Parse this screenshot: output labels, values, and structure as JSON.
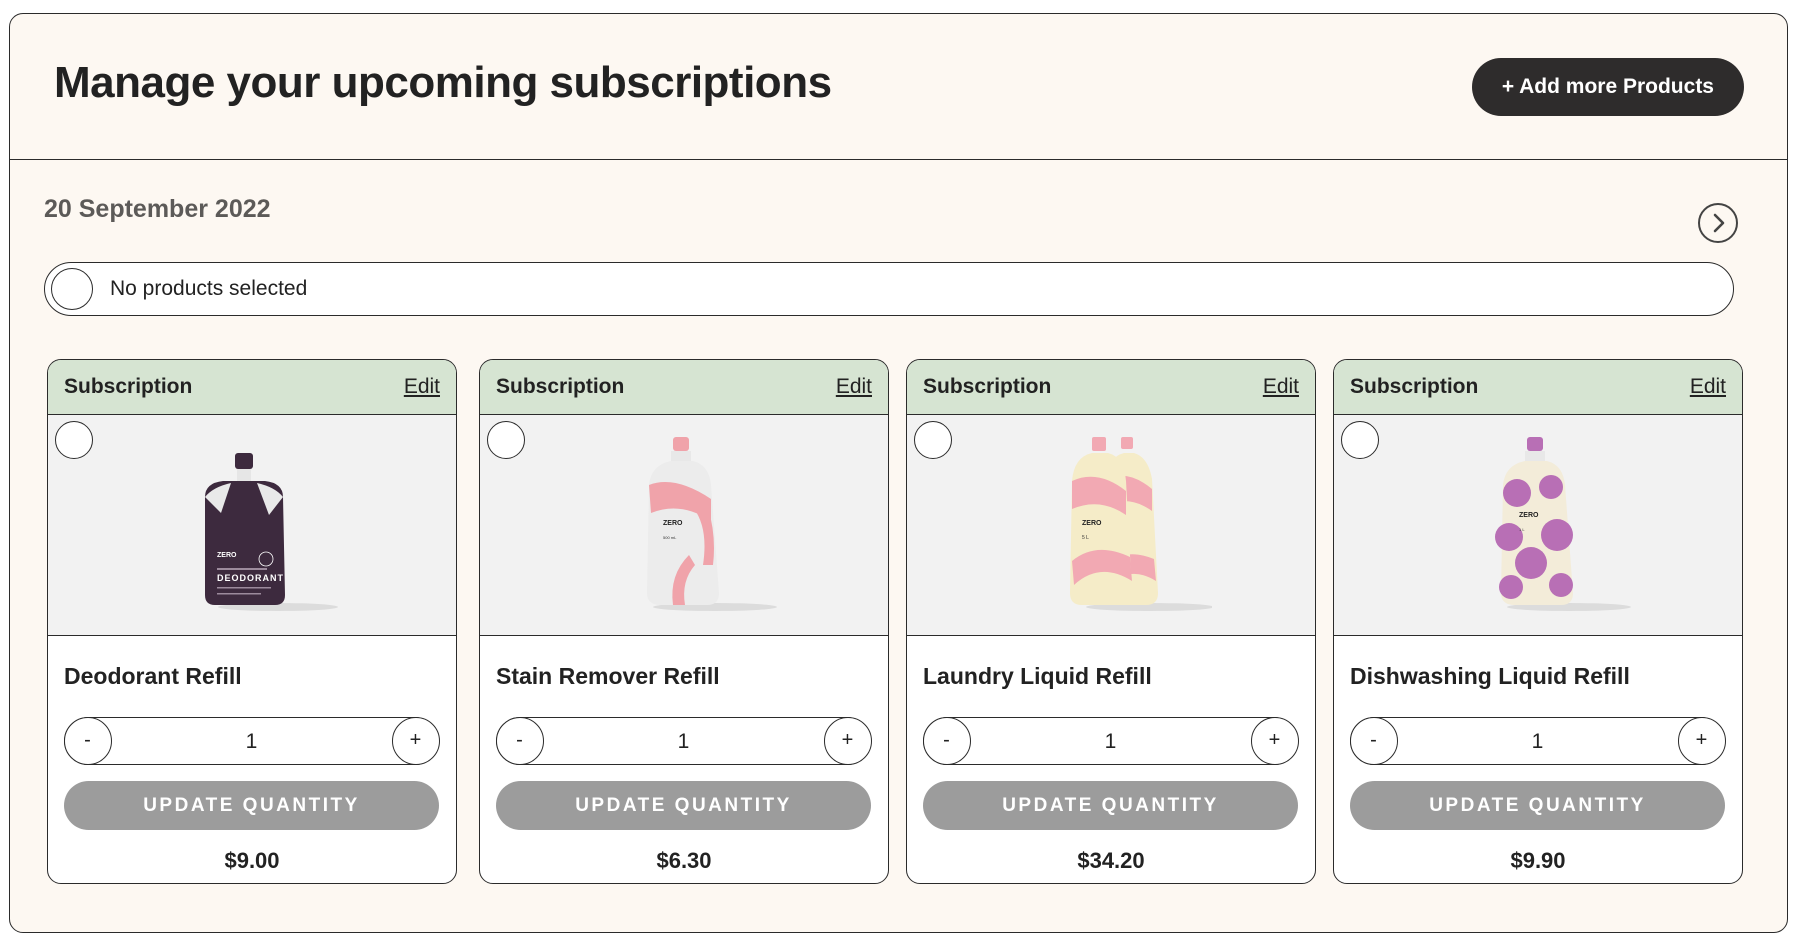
{
  "header": {
    "title": "Manage your upcoming subscriptions",
    "add_button": "+ Add more Products"
  },
  "delivery": {
    "date": "20 September 2022",
    "next_icon": "chevron-right-circle-icon"
  },
  "selection": {
    "status": "No products selected"
  },
  "products": [
    {
      "type": "Subscription",
      "edit": "Edit",
      "name": "Deodorant Refill",
      "quantity": "1",
      "minus": "-",
      "plus": "+",
      "update": "UPDATE QUANTITY",
      "price": "$9.00",
      "image": "deodorant-pouch",
      "color": "#3d2a3e"
    },
    {
      "type": "Subscription",
      "edit": "Edit",
      "name": "Stain Remover Refill",
      "quantity": "1",
      "minus": "-",
      "plus": "+",
      "update": "UPDATE QUANTITY",
      "price": "$6.30",
      "image": "stain-remover-pouch",
      "color": "#f0a3aa"
    },
    {
      "type": "Subscription",
      "edit": "Edit",
      "name": "Laundry Liquid Refill",
      "quantity": "1",
      "minus": "-",
      "plus": "+",
      "update": "UPDATE QUANTITY",
      "price": "$34.20",
      "image": "laundry-liquid-pouches",
      "color": "#f2a9b3"
    },
    {
      "type": "Subscription",
      "edit": "Edit",
      "name": "Dishwashing Liquid Refill",
      "quantity": "1",
      "minus": "-",
      "plus": "+",
      "update": "UPDATE QUANTITY",
      "price": "$9.90",
      "image": "dishwashing-liquid-pouch",
      "color": "#b86fb5"
    }
  ],
  "colors": {
    "panel_bg": "#fdf8f2",
    "card_header_bg": "#d6e4d2",
    "primary_button": "#2e2c2c",
    "update_button": "#9c9c9c"
  }
}
